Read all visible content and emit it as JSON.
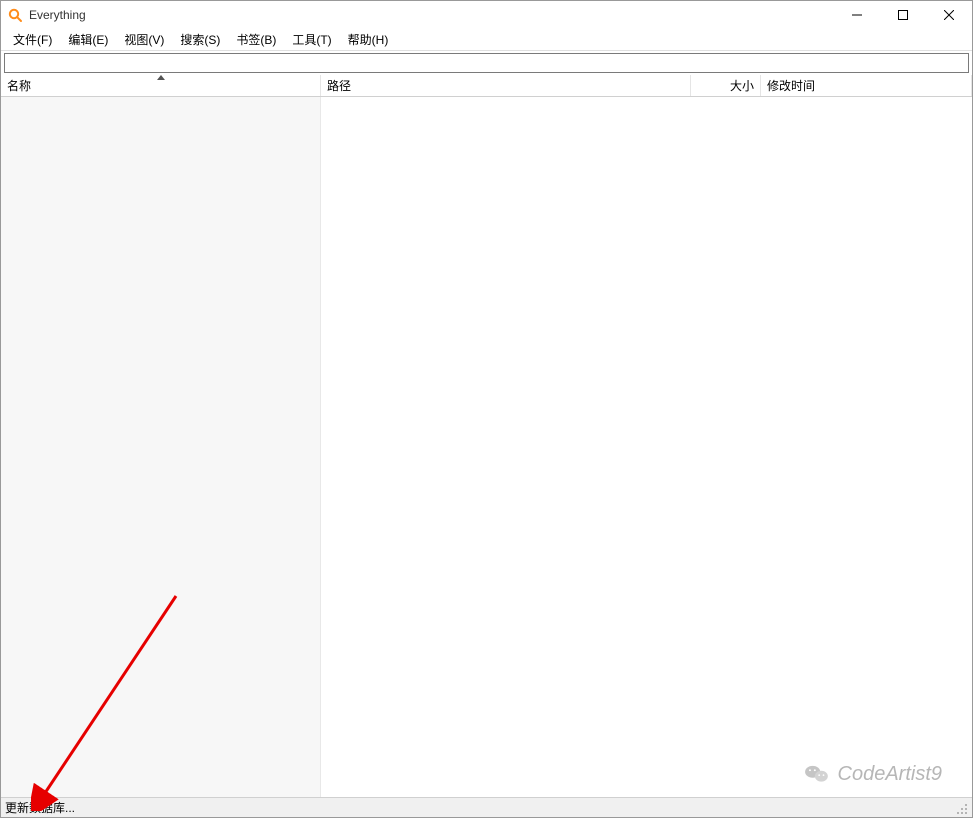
{
  "window": {
    "title": "Everything"
  },
  "menu": {
    "file": "文件(F)",
    "edit": "编辑(E)",
    "view": "视图(V)",
    "search": "搜索(S)",
    "bookmark": "书签(B)",
    "tools": "工具(T)",
    "help": "帮助(H)"
  },
  "search_input": {
    "value": "",
    "placeholder": ""
  },
  "columns": {
    "name": "名称",
    "path": "路径",
    "size": "大小",
    "mtime": "修改时间"
  },
  "status": {
    "text": "更新数据库..."
  },
  "watermark": {
    "text": "CodeArtist9"
  }
}
